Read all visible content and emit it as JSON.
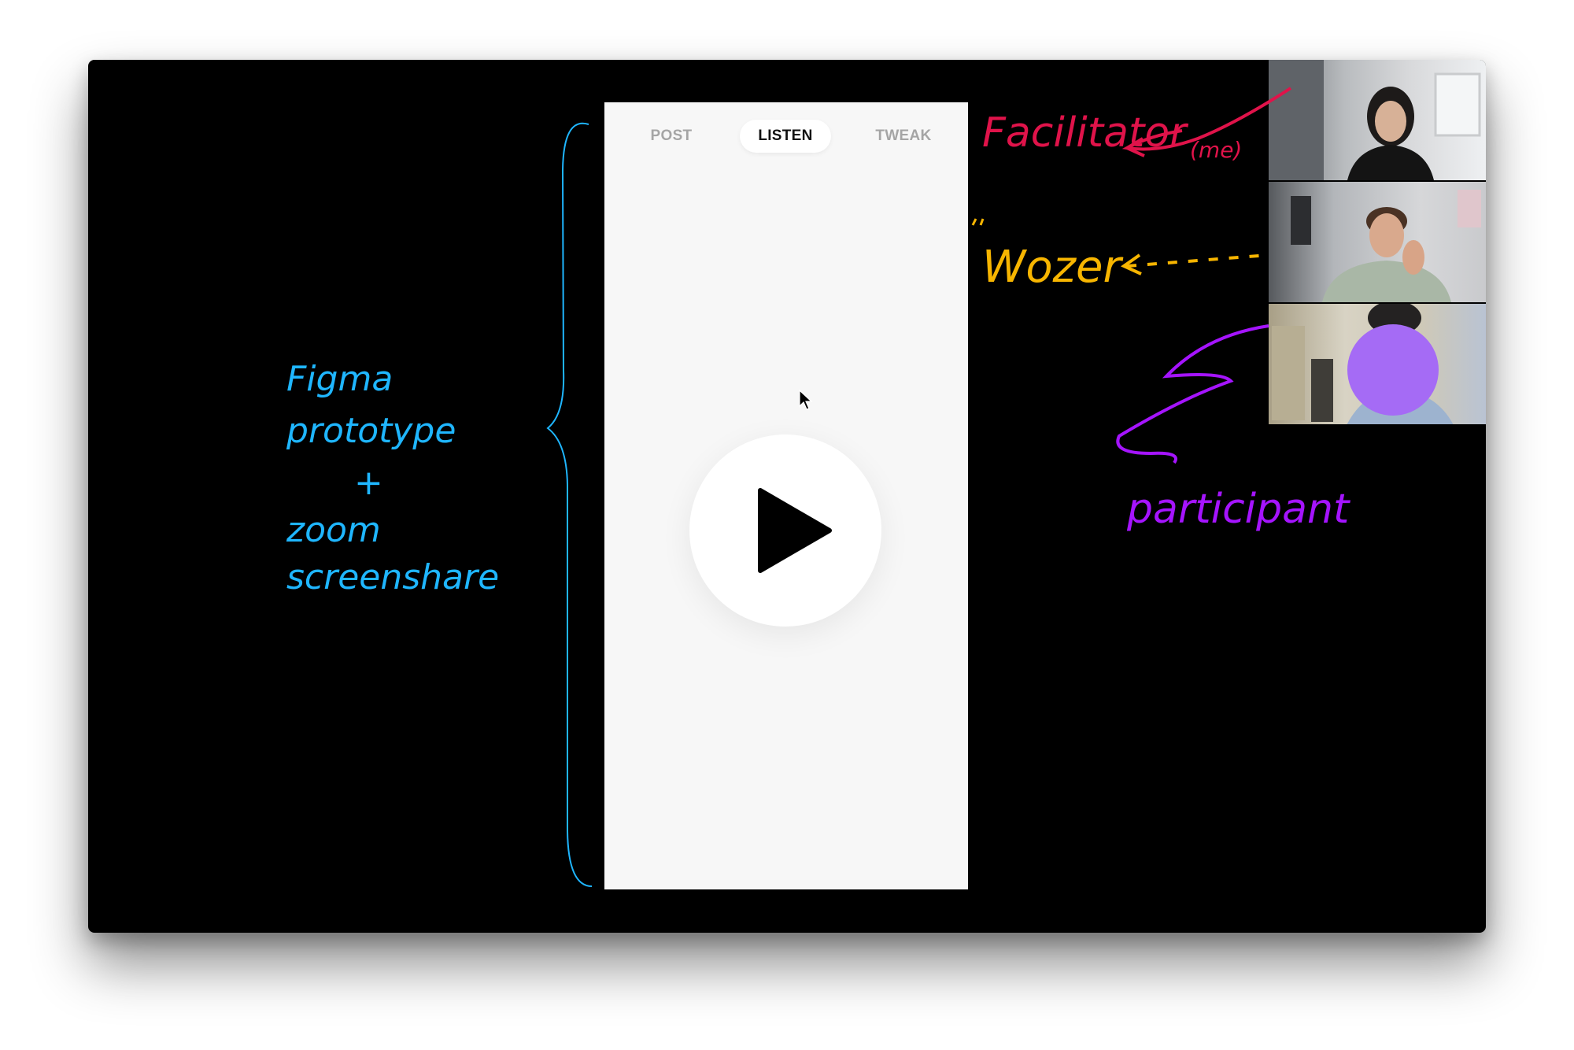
{
  "prototype": {
    "tabs": [
      {
        "label": "POST",
        "active": false
      },
      {
        "label": "LISTEN",
        "active": true
      },
      {
        "label": "TWEAK",
        "active": false
      }
    ],
    "play_icon": "play-icon",
    "cursor_icon": "cursor-arrow-icon"
  },
  "annotations": {
    "left_note": {
      "line1": "Figma",
      "line2": "prototype",
      "line3": "+",
      "line4": "zoom",
      "line5": "screenshare",
      "color": "#1fb6ff"
    },
    "facilitator": {
      "label": "Facilitator",
      "sub": "(me)",
      "color": "#e0134a"
    },
    "wozer": {
      "label": "Wozer",
      "color": "#f7b500"
    },
    "participant": {
      "label": "participant",
      "color": "#a514ff"
    }
  },
  "video_tiles": {
    "avatar_color": "#a56bf5"
  },
  "colors": {
    "background": "#000000",
    "prototype_bg": "#f7f7f7",
    "active_tab_text": "#111111",
    "inactive_tab_text": "#a5a5a5"
  }
}
